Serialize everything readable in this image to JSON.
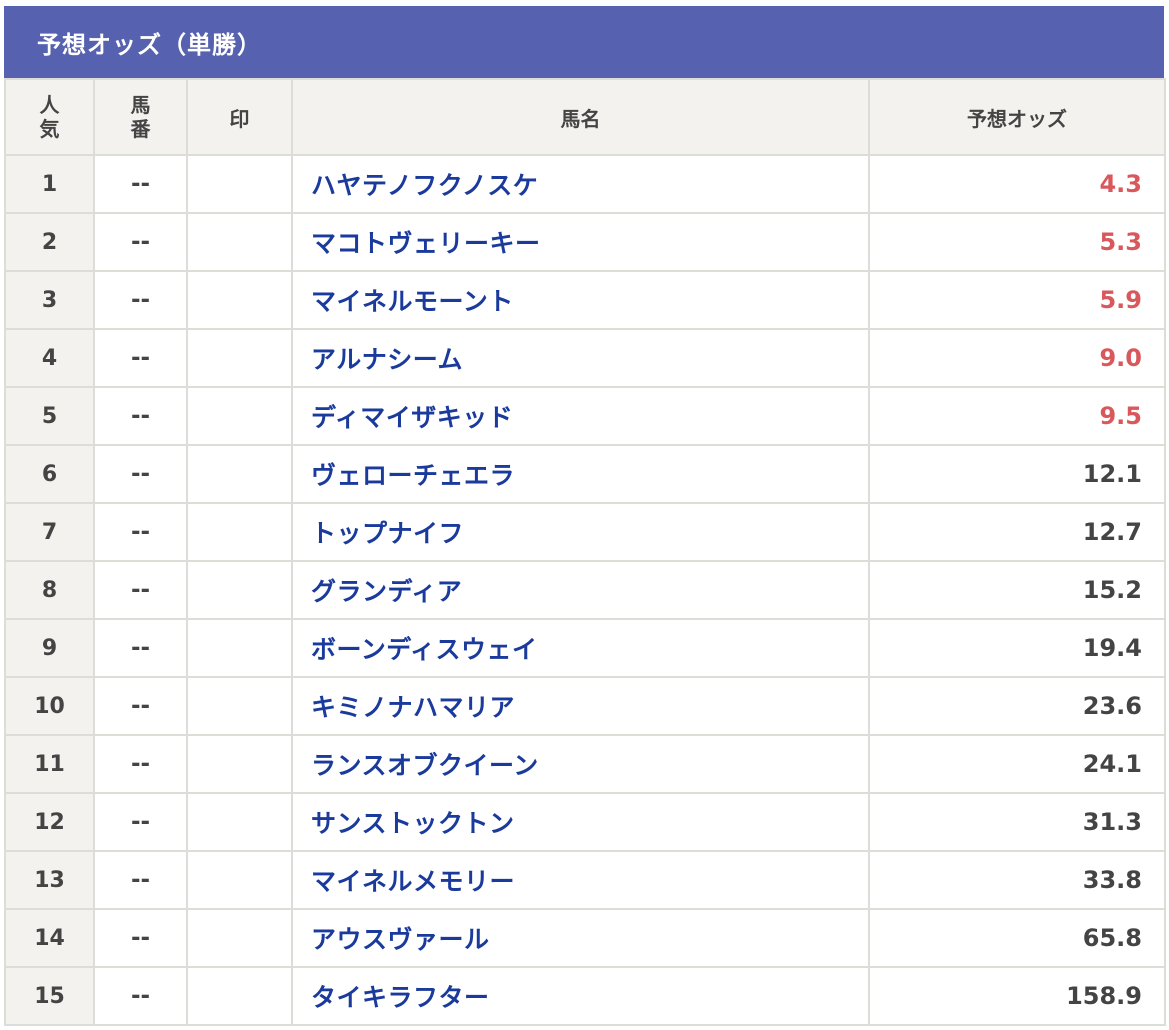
{
  "title": "予想オッズ（単勝）",
  "columns": {
    "ninki": [
      "人",
      "気"
    ],
    "umaban": [
      "馬",
      "番"
    ],
    "shirushi": "印",
    "horse_name": "馬名",
    "odds": "予想オッズ"
  },
  "colors": {
    "header_bg": "#5661b0",
    "horse_name": "#1a3a9c",
    "top_odds": "#d9585c",
    "odds": "#444444",
    "cell_bg_alt": "#f3f2ee"
  },
  "rows": [
    {
      "rank": "1",
      "umaban": "--",
      "mark": "",
      "name": "ハヤテノフクノスケ",
      "odds": "4.3",
      "highlight": true
    },
    {
      "rank": "2",
      "umaban": "--",
      "mark": "",
      "name": "マコトヴェリーキー",
      "odds": "5.3",
      "highlight": true
    },
    {
      "rank": "3",
      "umaban": "--",
      "mark": "",
      "name": "マイネルモーント",
      "odds": "5.9",
      "highlight": true
    },
    {
      "rank": "4",
      "umaban": "--",
      "mark": "",
      "name": "アルナシーム",
      "odds": "9.0",
      "highlight": true
    },
    {
      "rank": "5",
      "umaban": "--",
      "mark": "",
      "name": "ディマイザキッド",
      "odds": "9.5",
      "highlight": true
    },
    {
      "rank": "6",
      "umaban": "--",
      "mark": "",
      "name": "ヴェローチェエラ",
      "odds": "12.1",
      "highlight": false
    },
    {
      "rank": "7",
      "umaban": "--",
      "mark": "",
      "name": "トップナイフ",
      "odds": "12.7",
      "highlight": false
    },
    {
      "rank": "8",
      "umaban": "--",
      "mark": "",
      "name": "グランディア",
      "odds": "15.2",
      "highlight": false
    },
    {
      "rank": "9",
      "umaban": "--",
      "mark": "",
      "name": "ボーンディスウェイ",
      "odds": "19.4",
      "highlight": false
    },
    {
      "rank": "10",
      "umaban": "--",
      "mark": "",
      "name": "キミノナハマリア",
      "odds": "23.6",
      "highlight": false
    },
    {
      "rank": "11",
      "umaban": "--",
      "mark": "",
      "name": "ランスオブクイーン",
      "odds": "24.1",
      "highlight": false
    },
    {
      "rank": "12",
      "umaban": "--",
      "mark": "",
      "name": "サンストックトン",
      "odds": "31.3",
      "highlight": false
    },
    {
      "rank": "13",
      "umaban": "--",
      "mark": "",
      "name": "マイネルメモリー",
      "odds": "33.8",
      "highlight": false
    },
    {
      "rank": "14",
      "umaban": "--",
      "mark": "",
      "name": "アウスヴァール",
      "odds": "65.8",
      "highlight": false
    },
    {
      "rank": "15",
      "umaban": "--",
      "mark": "",
      "name": "タイキラフター",
      "odds": "158.9",
      "highlight": false
    }
  ]
}
